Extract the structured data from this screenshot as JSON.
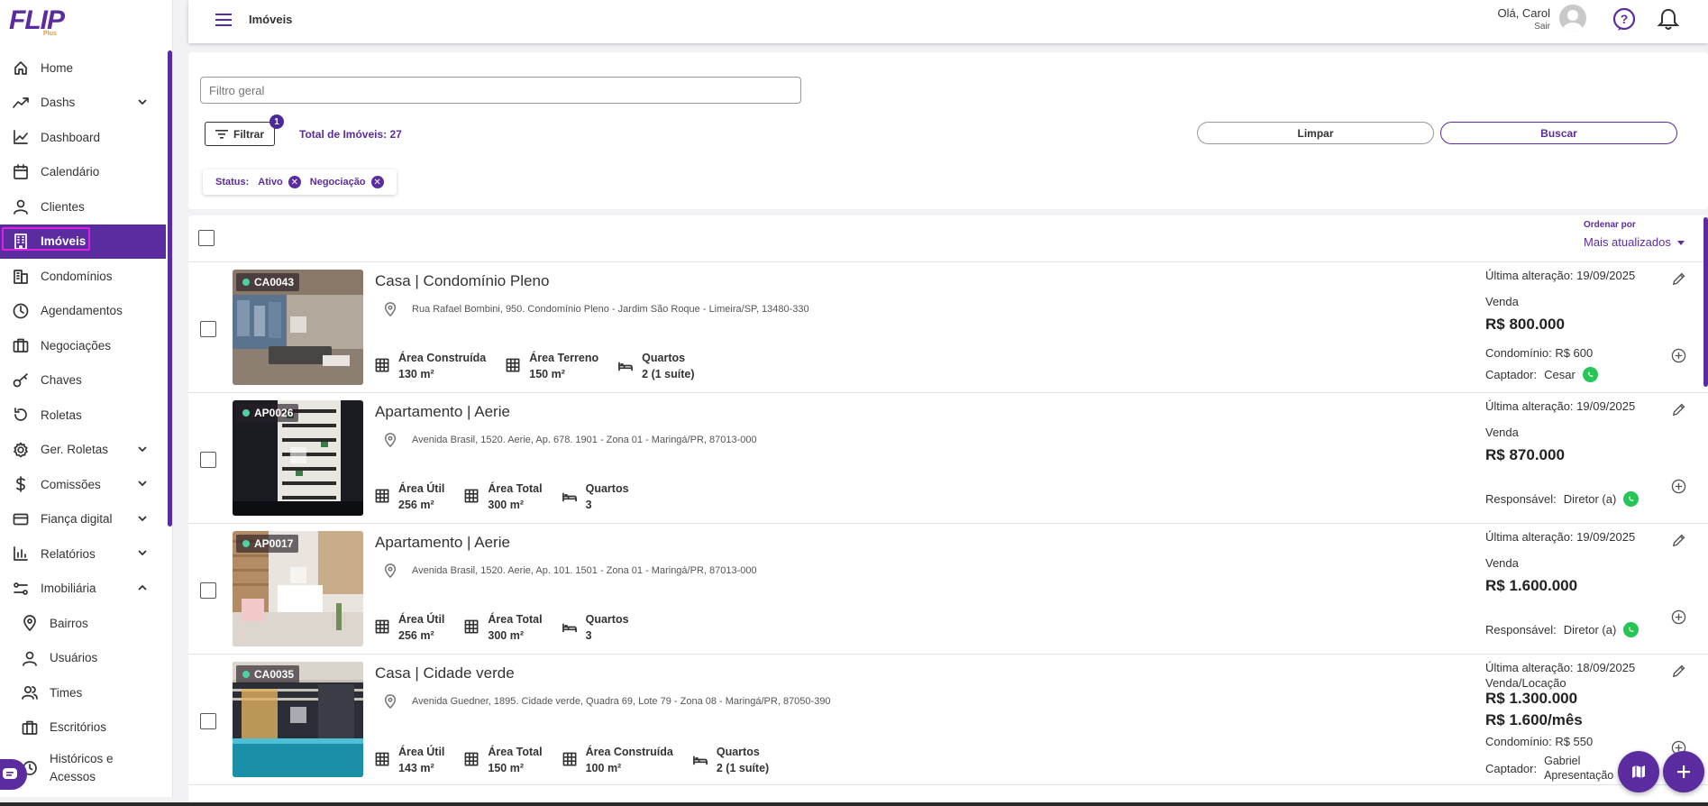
{
  "brand": {
    "logo": "FLIP",
    "logo_sub": "Plus",
    "accent": "#5b2ca0"
  },
  "header": {
    "title": "Imóveis",
    "greeting": "Olá, Carol",
    "logout": "Sair"
  },
  "sidebar": {
    "items": [
      {
        "label": "Home",
        "icon": "home-icon"
      },
      {
        "label": "Dashs",
        "icon": "trend-icon",
        "chevron": "down"
      },
      {
        "label": "Dashboard",
        "icon": "chart-line-icon"
      },
      {
        "label": "Calendário",
        "icon": "calendar-icon"
      },
      {
        "label": "Clientes",
        "icon": "user-icon"
      },
      {
        "label": "Imóveis",
        "icon": "building-icon",
        "active": true
      },
      {
        "label": "Condomínios",
        "icon": "buildings-icon"
      },
      {
        "label": "Agendamentos",
        "icon": "clock-icon"
      },
      {
        "label": "Negociações",
        "icon": "briefcase-icon"
      },
      {
        "label": "Chaves",
        "icon": "key-icon"
      },
      {
        "label": "Roletas",
        "icon": "rotate-icon"
      },
      {
        "label": "Ger. Roletas",
        "icon": "gear-icon",
        "chevron": "down"
      },
      {
        "label": "Comissões",
        "icon": "dollar-icon",
        "chevron": "down"
      },
      {
        "label": "Fiança digital",
        "icon": "card-icon",
        "chevron": "down"
      },
      {
        "label": "Relatórios",
        "icon": "bar-chart-icon",
        "chevron": "down"
      },
      {
        "label": "Imobiliária",
        "icon": "sliders-icon",
        "chevron": "up"
      },
      {
        "label": "Bairros",
        "icon": "pin-icon",
        "sub": true
      },
      {
        "label": "Usuários",
        "icon": "user-icon",
        "sub": true
      },
      {
        "label": "Times",
        "icon": "users-icon",
        "sub": true
      },
      {
        "label": "Escritórios",
        "icon": "briefcase-icon",
        "sub": true
      },
      {
        "label": "Históricos e Acessos",
        "icon": "history-icon",
        "sub": true
      }
    ]
  },
  "filters": {
    "search_placeholder": "Filtro geral",
    "filter_button": "Filtrar",
    "filter_count": "1",
    "total": "Total de Imóveis: 27",
    "clear": "Limpar",
    "search": "Buscar",
    "chips": {
      "label": "Status:",
      "values": [
        "Ativo",
        "Negociação"
      ]
    }
  },
  "order": {
    "label": "Ordenar por",
    "value": "Mais atualizados"
  },
  "listings": [
    {
      "code": "CA0043",
      "title": "Casa | Condomínio Pleno",
      "address": "Rua Rafael Bombini, 950. Condomínio Pleno - Jardim São Roque - Limeira/SP, 13480-330",
      "features": [
        {
          "label": "Área Construída",
          "value": "130 m²",
          "icon": "grid-icon"
        },
        {
          "label": "Área Terreno",
          "value": "150 m²",
          "icon": "grid-icon"
        },
        {
          "label": "Quartos",
          "value": "2 (1 suíte)",
          "icon": "bed-icon"
        }
      ],
      "updated": "Última alteração: 19/09/2025",
      "deal": "Venda",
      "prices": [
        "R$ 800.000"
      ],
      "condo": "Condomínio: R$ 600",
      "agent_label": "Captador:",
      "agent": "Cesar"
    },
    {
      "code": "AP0026",
      "title": "Apartamento | Aerie",
      "address": "Avenida Brasil, 1520. Aerie, Ap. 678. 1901 - Zona 01 - Maringá/PR, 87013-000",
      "features": [
        {
          "label": "Área Útil",
          "value": "256 m²",
          "icon": "grid-icon"
        },
        {
          "label": "Área Total",
          "value": "300 m²",
          "icon": "grid-icon"
        },
        {
          "label": "Quartos",
          "value": "3",
          "icon": "bed-icon"
        }
      ],
      "updated": "Última alteração: 19/09/2025",
      "deal": "Venda",
      "prices": [
        "R$ 870.000"
      ],
      "condo": "",
      "agent_label": "Responsável:",
      "agent": "Diretor (a)"
    },
    {
      "code": "AP0017",
      "title": "Apartamento | Aerie",
      "address": "Avenida Brasil, 1520. Aerie, Ap. 101. 1501 - Zona 01 - Maringá/PR, 87013-000",
      "features": [
        {
          "label": "Área Útil",
          "value": "256 m²",
          "icon": "grid-icon"
        },
        {
          "label": "Área Total",
          "value": "300 m²",
          "icon": "grid-icon"
        },
        {
          "label": "Quartos",
          "value": "3",
          "icon": "bed-icon"
        }
      ],
      "updated": "Última alteração: 19/09/2025",
      "deal": "Venda",
      "prices": [
        "R$ 1.600.000"
      ],
      "condo": "",
      "agent_label": "Responsável:",
      "agent": "Diretor (a)"
    },
    {
      "code": "CA0035",
      "title": "Casa | Cidade verde",
      "address": "Avenida Guedner, 1895. Cidade verde, Quadra 69, Lote 79 - Zona 08 - Maringá/PR, 87050-390",
      "features": [
        {
          "label": "Área Útil",
          "value": "143 m²",
          "icon": "grid-icon"
        },
        {
          "label": "Área Total",
          "value": "150 m²",
          "icon": "grid-icon"
        },
        {
          "label": "Área Construída",
          "value": "100 m²",
          "icon": "grid-icon"
        },
        {
          "label": "Quartos",
          "value": "2 (1 suíte)",
          "icon": "bed-icon"
        }
      ],
      "updated": "Última alteração: 18/09/2025",
      "deal": "Venda/Locação",
      "prices": [
        "R$ 1.300.000",
        "R$ 1.600/mês"
      ],
      "condo": "Condomínio: R$ 550",
      "agent_label": "Captador:",
      "agent": "Gabriel Apresentação"
    }
  ]
}
